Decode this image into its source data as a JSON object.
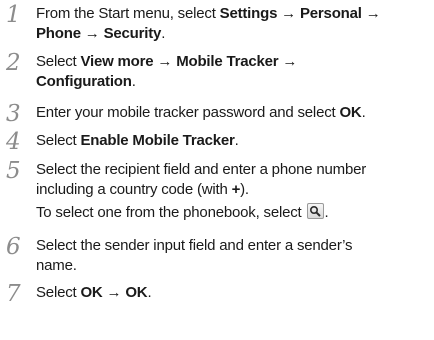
{
  "steps": [
    {
      "num": "1",
      "lines": [
        [
          {
            "t": "From the Start menu, select ",
            "b": false
          },
          {
            "t": "Settings",
            "b": true
          },
          {
            "t": " → ",
            "b": false
          },
          {
            "t": "Personal",
            "b": true
          },
          {
            "t": " →",
            "b": false
          }
        ],
        [
          {
            "t": "Phone",
            "b": true
          },
          {
            "t": " → ",
            "b": false
          },
          {
            "t": "Security",
            "b": true
          },
          {
            "t": ".",
            "b": false
          }
        ]
      ]
    },
    {
      "num": "2",
      "lines": [
        [
          {
            "t": "Select ",
            "b": false
          },
          {
            "t": "View more",
            "b": true
          },
          {
            "t": " → ",
            "b": false
          },
          {
            "t": "Mobile Tracker",
            "b": true
          },
          {
            "t": " →",
            "b": false
          }
        ],
        [
          {
            "t": "Configuration",
            "b": true
          },
          {
            "t": ".",
            "b": false
          }
        ]
      ]
    },
    {
      "num": "3",
      "lines": [
        [
          {
            "t": "Enter your mobile tracker password and select ",
            "b": false
          },
          {
            "t": "OK",
            "b": true
          },
          {
            "t": ".",
            "b": false
          }
        ]
      ]
    },
    {
      "num": "4",
      "lines": [
        [
          {
            "t": "Select ",
            "b": false
          },
          {
            "t": "Enable Mobile Tracker",
            "b": true
          },
          {
            "t": ".",
            "b": false
          }
        ]
      ]
    },
    {
      "num": "5",
      "lines": [
        [
          {
            "t": "Select the recipient field and enter a phone number",
            "b": false
          }
        ],
        [
          {
            "t": "including a country code (with ",
            "b": false
          },
          {
            "t": "+",
            "b": true
          },
          {
            "t": ").",
            "b": false
          }
        ],
        [
          {
            "t": "To select one from the phonebook, select ",
            "b": false
          },
          {
            "icon": "search-icon"
          },
          {
            "t": ".",
            "b": false
          }
        ]
      ]
    },
    {
      "num": "6",
      "lines": [
        [
          {
            "t": "Select the sender input field and enter a sender’s",
            "b": false
          }
        ],
        [
          {
            "t": "name.",
            "b": false
          }
        ]
      ]
    },
    {
      "num": "7",
      "lines": [
        [
          {
            "t": "Select ",
            "b": false
          },
          {
            "t": "OK",
            "b": true
          },
          {
            "t": " → ",
            "b": false
          },
          {
            "t": "OK",
            "b": true
          },
          {
            "t": ".",
            "b": false
          }
        ]
      ]
    }
  ]
}
